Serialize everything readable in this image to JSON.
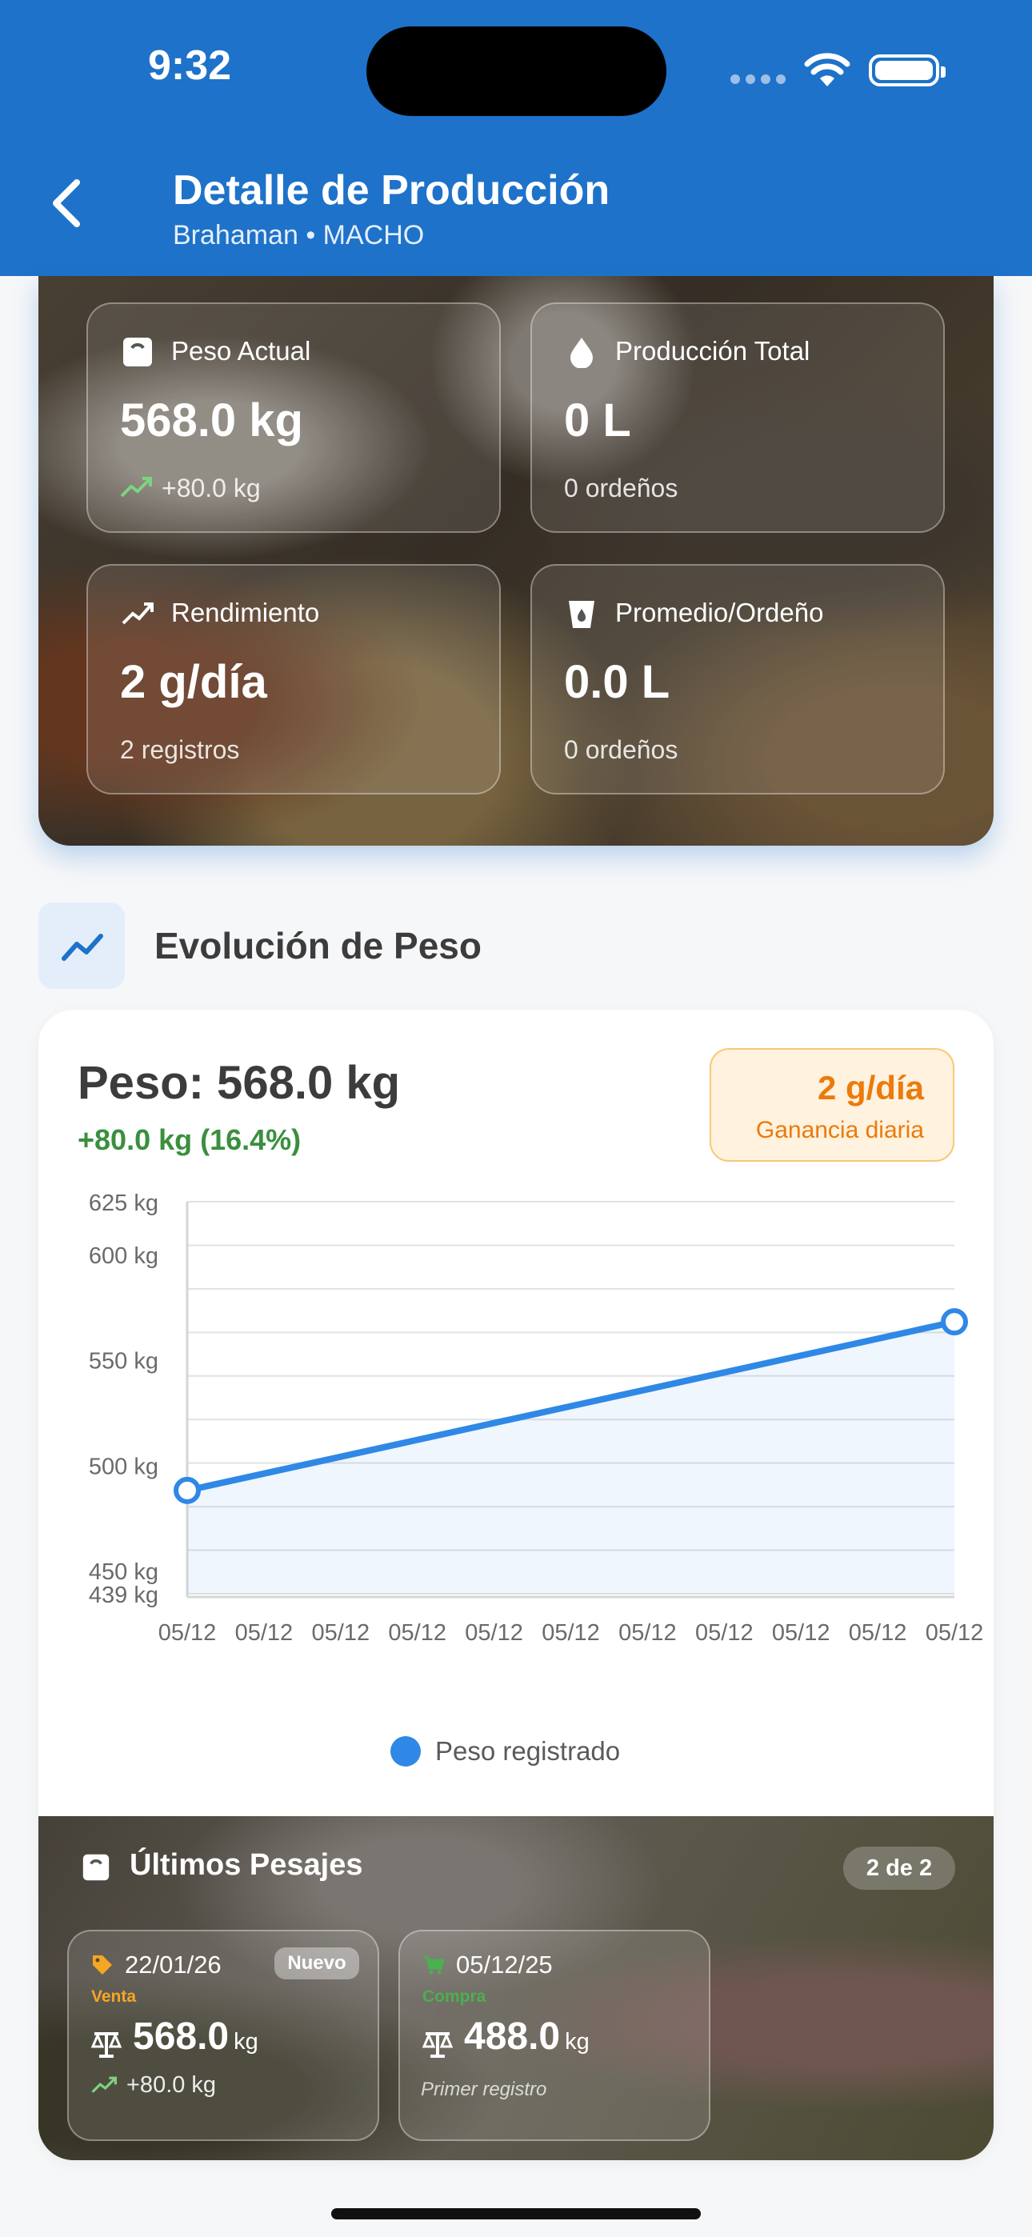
{
  "status_bar": {
    "time": "9:32"
  },
  "header": {
    "title": "Detalle de Producción",
    "subtitle": "Brahaman • MACHO"
  },
  "stats": [
    {
      "icon": "scale-icon",
      "label": "Peso Actual",
      "value": "568.0 kg",
      "sub": "+80.0 kg"
    },
    {
      "icon": "drop-icon",
      "label": "Producción Total",
      "value": "0 L",
      "sub": "0 ordeños"
    },
    {
      "icon": "trend-icon",
      "label": "Rendimiento",
      "value": "2 g/día",
      "sub": "2 registros"
    },
    {
      "icon": "cup-icon",
      "label": "Promedio/Ordeño",
      "value": "0.0 L",
      "sub": "0 ordeños"
    }
  ],
  "section": {
    "title": "Evolución de Peso"
  },
  "weight_summary": {
    "title": "Peso: 568.0 kg",
    "change": "+80.0 kg (16.4%)",
    "gain_value": "2 g/día",
    "gain_label": "Ganancia diaria"
  },
  "chart_data": {
    "type": "line",
    "x": [
      "05/12",
      "05/12",
      "05/12",
      "05/12",
      "05/12",
      "05/12",
      "05/12",
      "05/12",
      "05/12",
      "05/12",
      "05/12"
    ],
    "points": [
      {
        "xi": 0,
        "y": 488
      },
      {
        "xi": 10,
        "y": 568
      }
    ],
    "ylim": [
      439,
      625
    ],
    "yticks": [
      439,
      450,
      500,
      550,
      600,
      625
    ],
    "ytick_labels": [
      "439 kg",
      "450 kg",
      "500 kg",
      "550 kg",
      "600 kg",
      "625 kg"
    ],
    "grid": true,
    "legend": "Peso registrado",
    "color": "#2f88e6"
  },
  "weighings": {
    "title": "Últimos Pesajes",
    "count": "2 de 2",
    "items": [
      {
        "date": "22/01/26",
        "type": "Venta",
        "type_color": "#f5a623",
        "badge": "Nuevo",
        "weight": "568.0",
        "unit": "kg",
        "sub": "+80.0 kg"
      },
      {
        "date": "05/12/25",
        "type": "Compra",
        "type_color": "#4caf50",
        "badge": "",
        "weight": "488.0",
        "unit": "kg",
        "sub": "Primer registro"
      }
    ]
  },
  "colors": {
    "header": "#1e72c9",
    "accent": "#2f88e6",
    "gain": "#ec7a0c",
    "positive": "#3a8f3e"
  }
}
